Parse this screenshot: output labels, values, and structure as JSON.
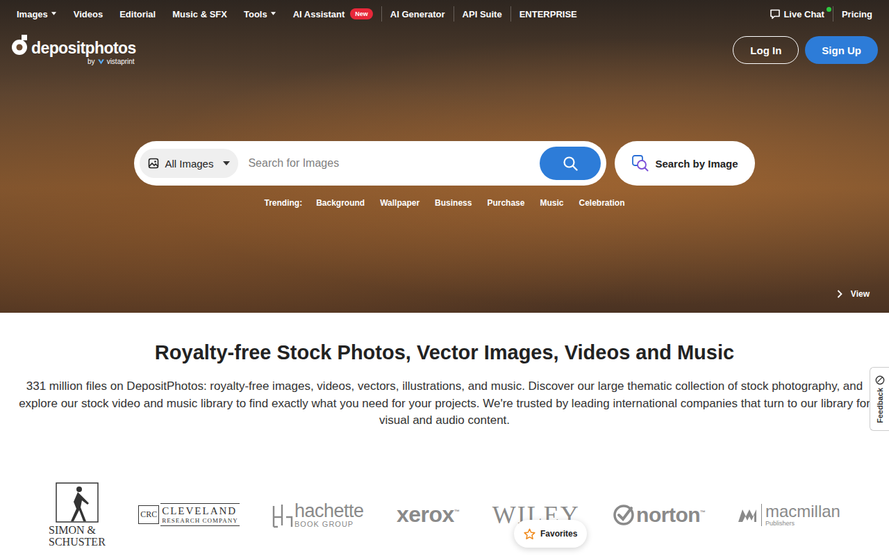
{
  "nav": {
    "items": [
      {
        "label": "Images",
        "dropdown": true,
        "badge": "",
        "divider_before": false
      },
      {
        "label": "Videos",
        "dropdown": false,
        "badge": "",
        "divider_before": false
      },
      {
        "label": "Editorial",
        "dropdown": false,
        "badge": "",
        "divider_before": false
      },
      {
        "label": "Music & SFX",
        "dropdown": false,
        "badge": "",
        "divider_before": false
      },
      {
        "label": "Tools",
        "dropdown": true,
        "badge": "",
        "divider_before": false
      },
      {
        "label": "AI Assistant",
        "dropdown": false,
        "badge": "New",
        "divider_before": false
      },
      {
        "label": "AI Generator",
        "dropdown": false,
        "badge": "",
        "divider_before": true
      },
      {
        "label": "API Suite",
        "dropdown": false,
        "badge": "",
        "divider_before": true
      },
      {
        "label": "ENTERPRISE",
        "dropdown": false,
        "badge": "",
        "divider_before": true
      }
    ],
    "live_chat": {
      "label": "Live Chat",
      "online": true
    },
    "pricing": "Pricing"
  },
  "logo": {
    "name": "depositphotos",
    "by": "by",
    "partner": "vistaprint"
  },
  "auth": {
    "login": "Log In",
    "signup": "Sign Up"
  },
  "search": {
    "category": "All Images",
    "placeholder": "Search for Images",
    "by_image": "Search by Image"
  },
  "trending": {
    "label": "Trending:",
    "items": [
      "Background",
      "Wallpaper",
      "Business",
      "Purchase",
      "Music",
      "Celebration"
    ]
  },
  "hero_link": "View",
  "intro": {
    "title": "Royalty-free Stock Photos, Vector Images, Videos and Music",
    "text": "331 million files on DepositPhotos: royalty-free images, videos, vectors, illustrations, and music. Discover our large thematic collection of stock photography, and explore our stock video and music library to find exactly what you need for your projects. We're trusted by leading international companies that turn to our library for visual and audio content."
  },
  "clients": [
    {
      "kind": "simon",
      "lines": [
        "SIMON &",
        "SCHUSTER"
      ],
      "box": "",
      "mark": ""
    },
    {
      "kind": "crc",
      "lines": [
        "CLEVELAND",
        "RESEARCH COMPANY"
      ],
      "box": "CRC",
      "mark": ""
    },
    {
      "kind": "hachette",
      "lines": [
        "hachette",
        "BOOK GROUP"
      ],
      "box": "",
      "mark": ""
    },
    {
      "kind": "xerox",
      "lines": [
        "xerox"
      ],
      "box": "",
      "mark": "™"
    },
    {
      "kind": "wiley",
      "lines": [
        "WILEY"
      ],
      "box": "",
      "mark": ""
    },
    {
      "kind": "norton",
      "lines": [
        "norton"
      ],
      "box": "",
      "mark": "™"
    },
    {
      "kind": "macmillan",
      "lines": [
        "macmillan",
        "Publishers"
      ],
      "box": "",
      "mark": ""
    }
  ],
  "favorites": "Favorites",
  "feedback": "Feedback"
}
